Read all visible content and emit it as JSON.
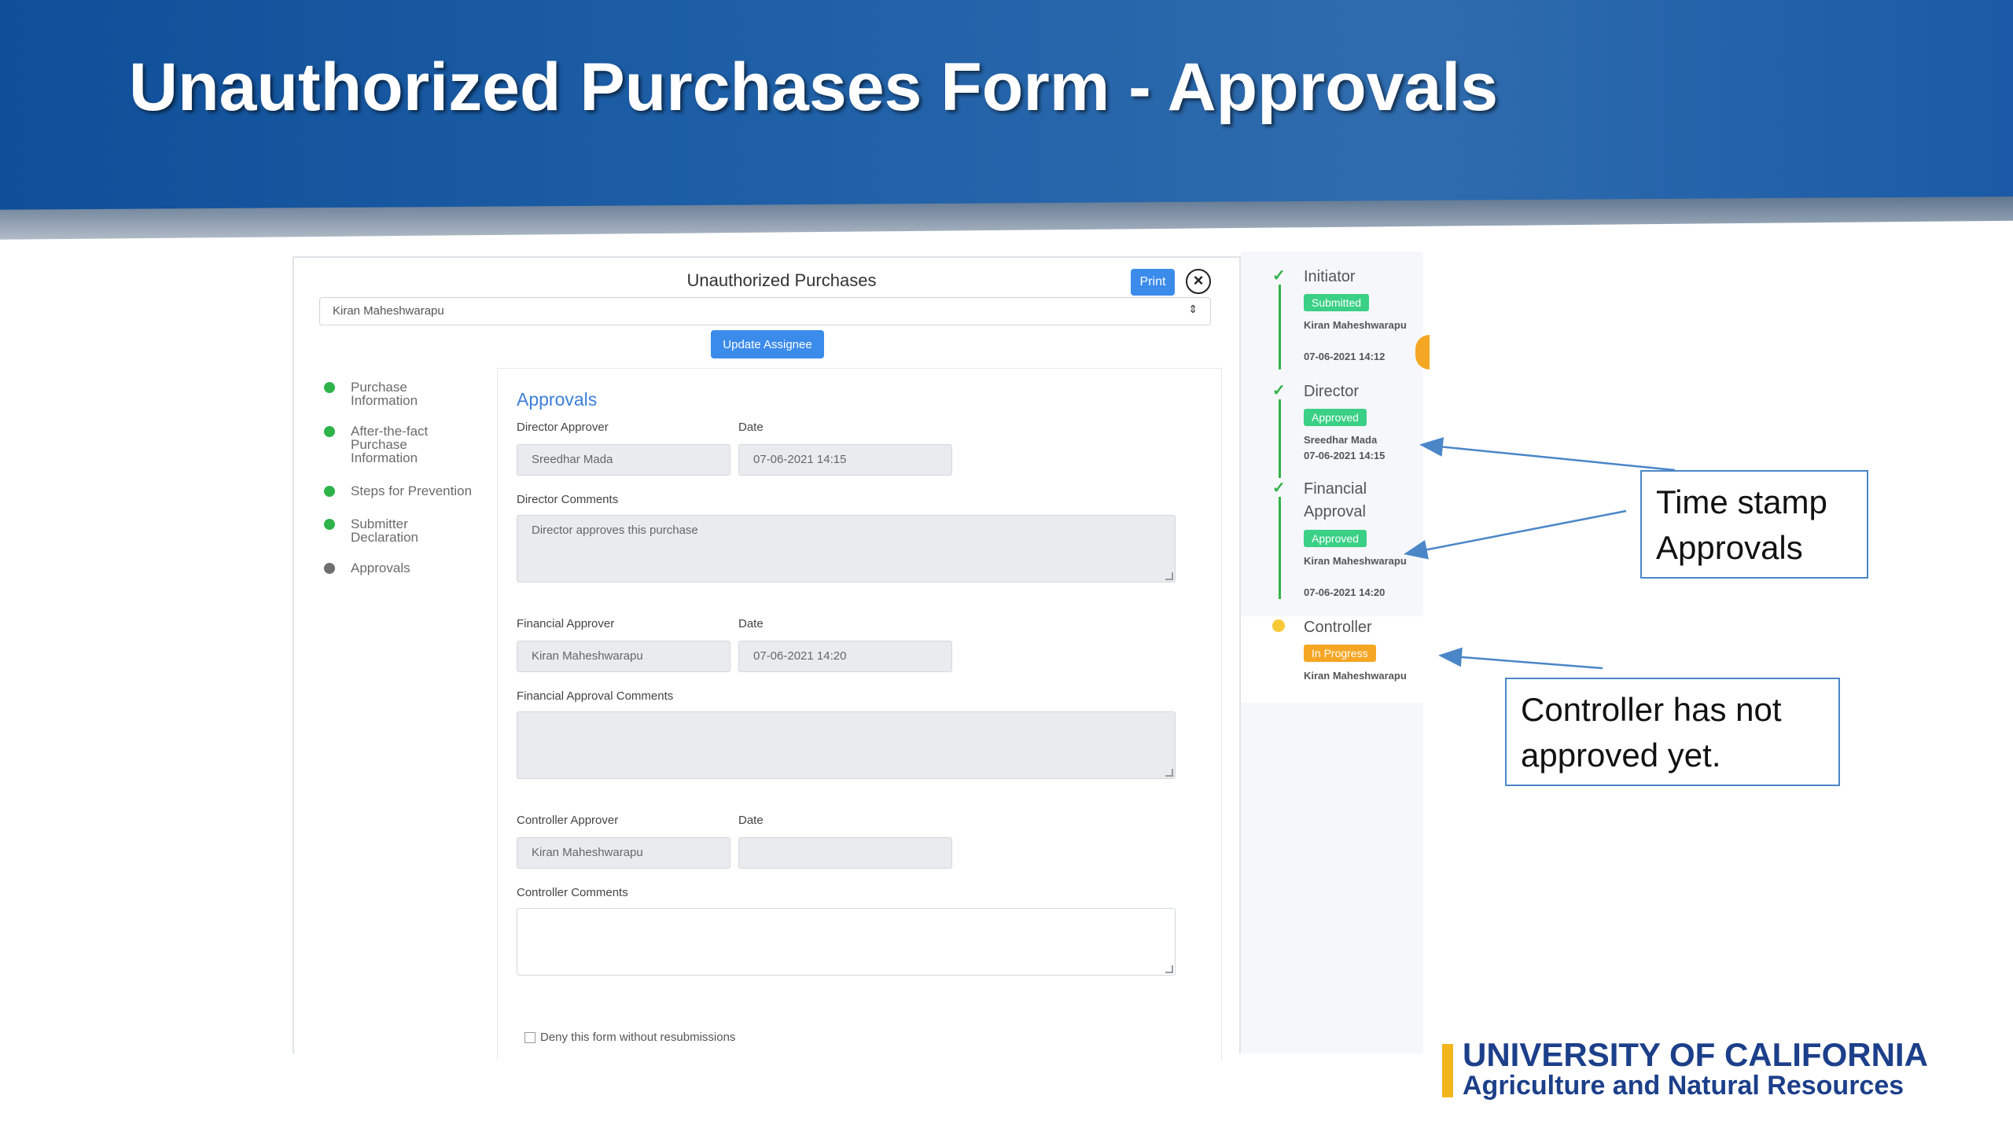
{
  "slide": {
    "title": "Unauthorized Purchases Form - Approvals"
  },
  "form": {
    "title": "Unauthorized Purchases",
    "print_label": "Print",
    "close_icon": "close-circle-icon",
    "assignee_value": "Kiran Maheshwarapu",
    "update_assignee_label": "Update Assignee"
  },
  "steps": [
    {
      "label": "Purchase Information",
      "status": "complete"
    },
    {
      "label": "After-the-fact Purchase Information",
      "status": "complete"
    },
    {
      "label": "Steps for Prevention",
      "status": "complete"
    },
    {
      "label": "Submitter Declaration",
      "status": "complete"
    },
    {
      "label": "Approvals",
      "status": "current"
    }
  ],
  "approvals": {
    "section_title": "Approvals",
    "director": {
      "approver_label": "Director Approver",
      "approver_value": "Sreedhar Mada",
      "date_label": "Date",
      "date_value": "07-06-2021 14:15",
      "comments_label": "Director Comments",
      "comments_value": "Director approves this purchase"
    },
    "financial": {
      "approver_label": "Financial Approver",
      "approver_value": "Kiran Maheshwarapu",
      "date_label": "Date",
      "date_value": "07-06-2021 14:20",
      "comments_label": "Financial Approval Comments",
      "comments_value": ""
    },
    "controller": {
      "approver_label": "Controller Approver",
      "approver_value": "Kiran Maheshwarapu",
      "date_label": "Date",
      "date_value": "",
      "comments_label": "Controller Comments",
      "comments_value": ""
    },
    "deny_label": "Deny this form without resubmissions"
  },
  "timeline": [
    {
      "name": "Initiator",
      "badge": "Submitted",
      "badge_color": "#3ad086",
      "person": "Kiran Maheshwarapu",
      "timestamp": "07-06-2021 14:12"
    },
    {
      "name": "Director",
      "badge": "Approved",
      "badge_color": "#3ad086",
      "person": "Sreedhar Mada",
      "timestamp": "07-06-2021 14:15"
    },
    {
      "name": "Financial Approval",
      "badge": "Approved",
      "badge_color": "#3ad086",
      "person": "Kiran Maheshwarapu",
      "timestamp": "07-06-2021 14:20"
    },
    {
      "name": "Controller",
      "badge": "In Progress",
      "badge_color": "#f5a623",
      "person": "Kiran Maheshwarapu",
      "timestamp": ""
    }
  ],
  "callouts": {
    "timestamp": "Time stamp Approvals",
    "controller": "Controller has not approved yet."
  },
  "logo": {
    "line1": "UNIVERSITY OF CALIFORNIA",
    "line2": "Agriculture and Natural Resources"
  },
  "colors": {
    "banner": "#1d5ea6",
    "accent_blue": "#3b8beb",
    "success_green": "#33b24a",
    "badge_green": "#3ad086",
    "in_progress_orange": "#f5a623",
    "logo_gold": "#f2b51c",
    "logo_navy": "#1c3f8a"
  }
}
